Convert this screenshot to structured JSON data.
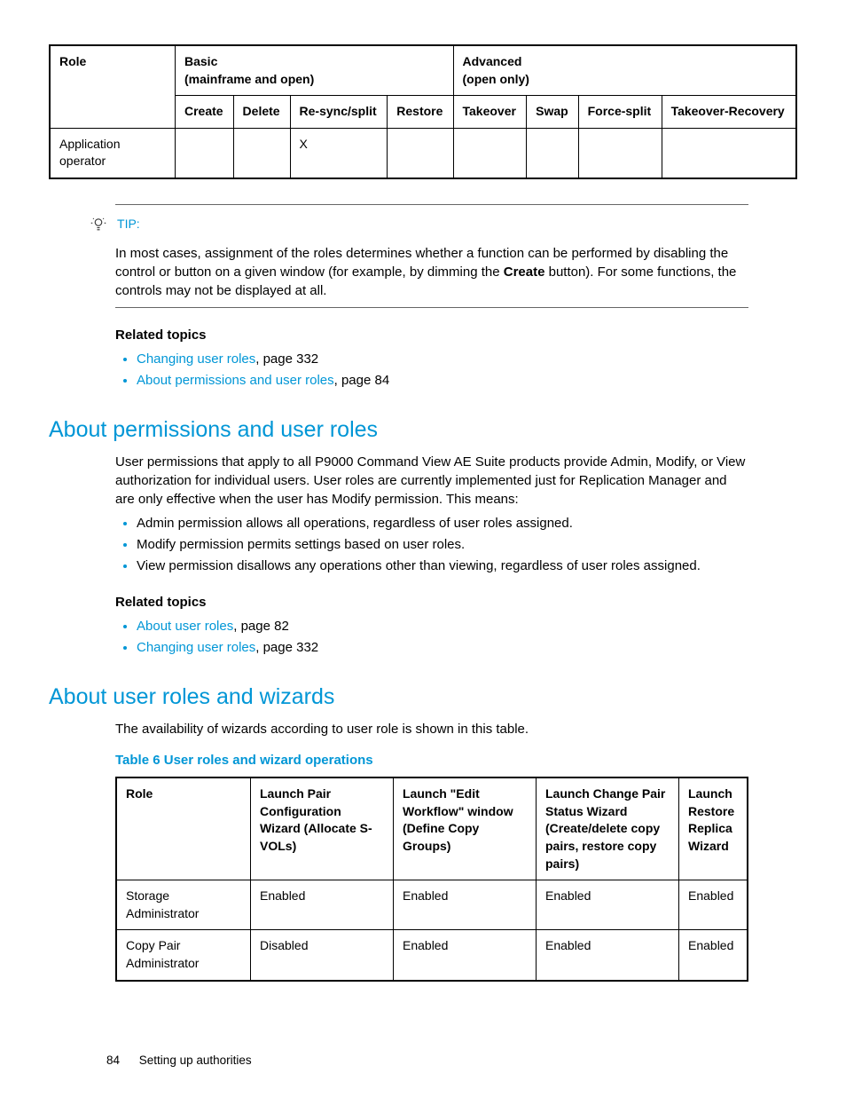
{
  "table1": {
    "h_role": "Role",
    "h_basic": "Basic",
    "h_basic_sub": "(mainframe and open)",
    "h_adv": "Advanced",
    "h_adv_sub": "(open only)",
    "cols": {
      "create": "Create",
      "delete": "Delete",
      "resync": "Re-sync/split",
      "restore": "Restore",
      "takeover": "Takeover",
      "swap": "Swap",
      "forcesplit": "Force-split",
      "takeoverrec": "Takeover-Recovery"
    },
    "row": {
      "role": "Application operator",
      "resync": "X"
    }
  },
  "tip": {
    "label": "TIP:",
    "text_pre": "In most cases, assignment of the roles determines whether a function can be performed by disabling the control or button on a given window (for example, by dimming the ",
    "bold": "Create",
    "text_post": " button). For some functions, the controls may not be displayed at all."
  },
  "related1": {
    "heading": "Related topics",
    "items": [
      {
        "link": "Changing user roles",
        "suffix": ", page 332"
      },
      {
        "link": "About permissions and user roles",
        "suffix": ", page 84"
      }
    ]
  },
  "sec1": {
    "title": "About permissions and user roles",
    "para": "User permissions that apply to all P9000 Command View AE Suite products provide Admin, Modify, or View authorization for individual users. User roles are currently implemented just for Replication Manager and are only effective when the user has Modify permission. This means:",
    "bullets": [
      "Admin permission allows all operations, regardless of user roles assigned.",
      "Modify permission permits settings based on user roles.",
      "View permission disallows any operations other than viewing, regardless of user roles assigned."
    ]
  },
  "related2": {
    "heading": "Related topics",
    "items": [
      {
        "link": "About user roles",
        "suffix": ", page 82"
      },
      {
        "link": "Changing user roles",
        "suffix": ", page 332"
      }
    ]
  },
  "sec2": {
    "title": "About user roles and wizards",
    "para": "The availability of wizards according to user role is shown in this table.",
    "caption": "Table 6 User roles and wizard operations"
  },
  "table2": {
    "headers": {
      "role": "Role",
      "c1": "Launch Pair Configuration Wizard (Allocate S-VOLs)",
      "c2": "Launch \"Edit Workflow\" window (Define Copy Groups)",
      "c3": "Launch Change Pair Status Wizard (Create/delete copy pairs, restore copy pairs)",
      "c4": "Launch Restore Replica Wizard"
    },
    "rows": [
      {
        "role": "Storage Administrator",
        "c1": "Enabled",
        "c2": "Enabled",
        "c3": "Enabled",
        "c4": "Enabled"
      },
      {
        "role": "Copy Pair Administrator",
        "c1": "Disabled",
        "c2": "Enabled",
        "c3": "Enabled",
        "c4": "Enabled"
      }
    ]
  },
  "footer": {
    "page": "84",
    "section": "Setting up authorities"
  }
}
